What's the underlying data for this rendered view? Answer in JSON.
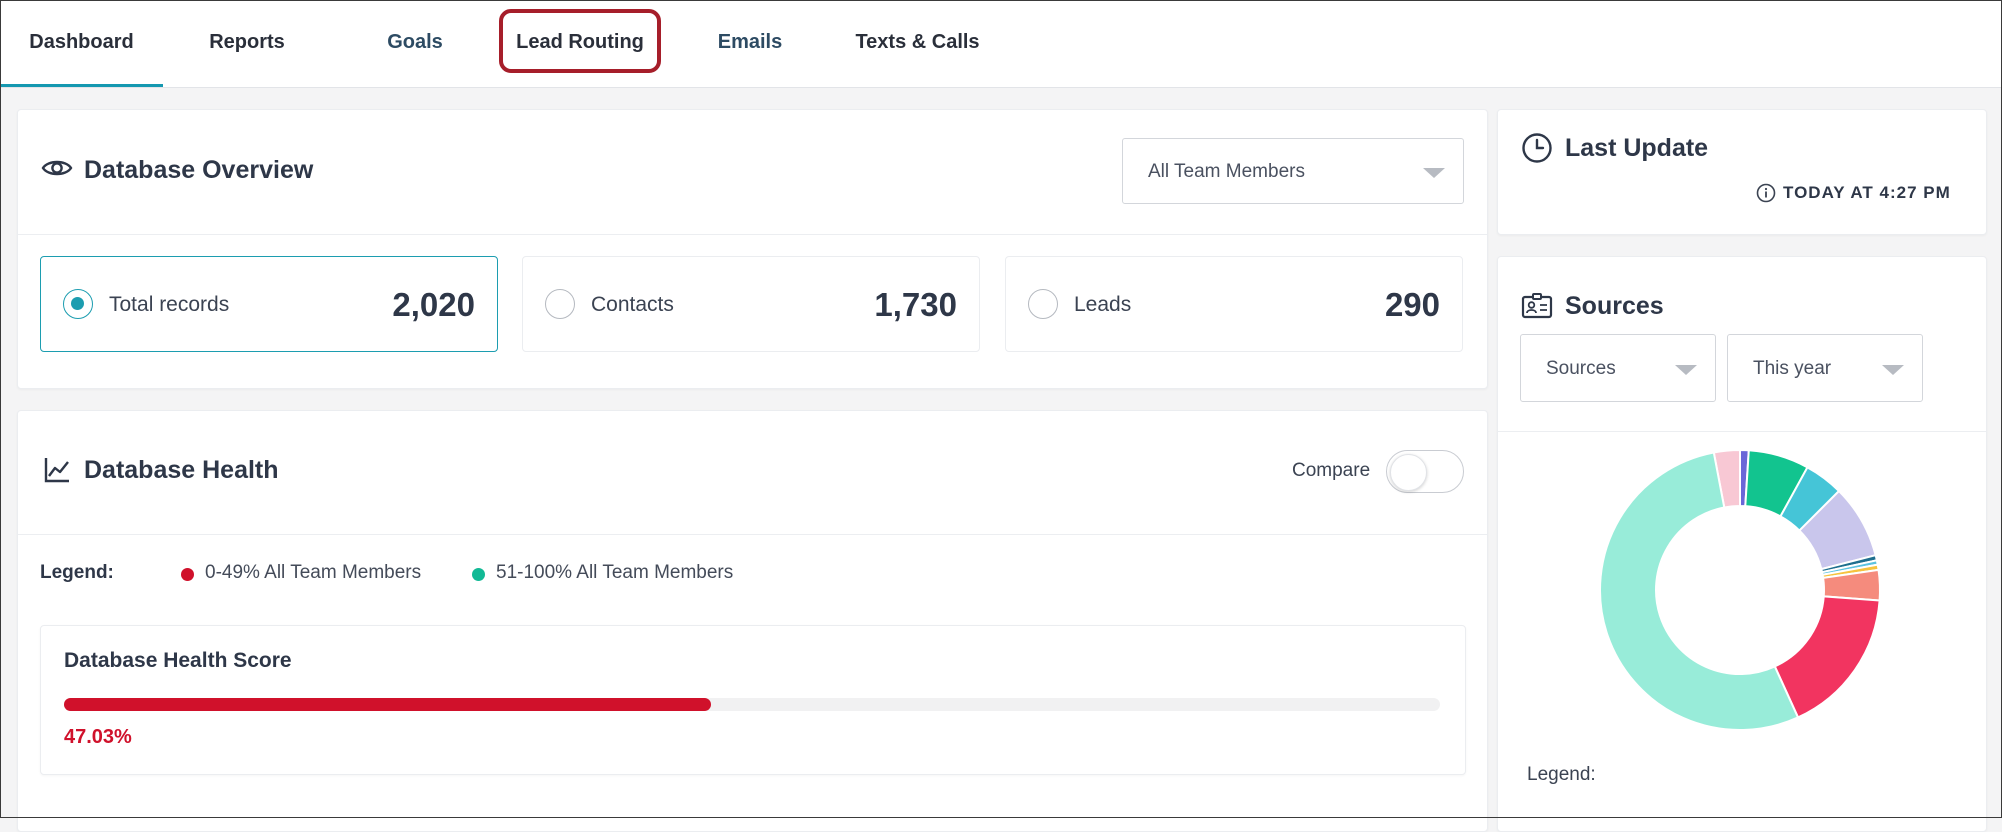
{
  "nav": {
    "tabs": [
      {
        "label": "Dashboard"
      },
      {
        "label": "Reports"
      },
      {
        "label": "Goals"
      },
      {
        "label": "Lead Routing"
      },
      {
        "label": "Emails"
      },
      {
        "label": "Texts & Calls"
      }
    ]
  },
  "overview": {
    "title": "Database Overview",
    "member_select": "All Team Members",
    "stats": [
      {
        "label": "Total records",
        "value": "2,020"
      },
      {
        "label": "Contacts",
        "value": "1,730"
      },
      {
        "label": "Leads",
        "value": "290"
      }
    ]
  },
  "health": {
    "title": "Database Health",
    "compare_label": "Compare",
    "legend_label": "Legend:",
    "legend_items": [
      {
        "label": "0-49% All Team Members",
        "color": "#d0112b"
      },
      {
        "label": "51-100% All Team Members",
        "color": "#12b995"
      }
    ],
    "score_title": "Database Health Score",
    "score_text": "47.03%",
    "score_value": 47.03,
    "score_color": "#d0112b"
  },
  "last_update": {
    "title": "Last Update",
    "time": "TODAY AT 4:27 PM"
  },
  "sources": {
    "title": "Sources",
    "source_select": "Sources",
    "period_select": "This year",
    "legend_label": "Legend:",
    "slices": [
      {
        "value": 3.0,
        "color": "#f8c8d4"
      },
      {
        "value": 1.0,
        "color": "#6a67d8"
      },
      {
        "value": 7.0,
        "color": "#12c48f"
      },
      {
        "value": 4.5,
        "color": "#45c5d7"
      },
      {
        "value": 8.5,
        "color": "#c9c6ec"
      },
      {
        "value": 0.6,
        "color": "#1e6f8e"
      },
      {
        "value": 0.5,
        "color": "#5bc2e0"
      },
      {
        "value": 0.6,
        "color": "#f6c33e"
      },
      {
        "value": 3.5,
        "color": "#f58b7d"
      },
      {
        "value": 17.0,
        "color": "#f23460"
      },
      {
        "value": 53.8,
        "color": "#98ecd9"
      }
    ]
  },
  "colors": {
    "accent": "#1c9db0",
    "highlight": "#a61e2a"
  }
}
